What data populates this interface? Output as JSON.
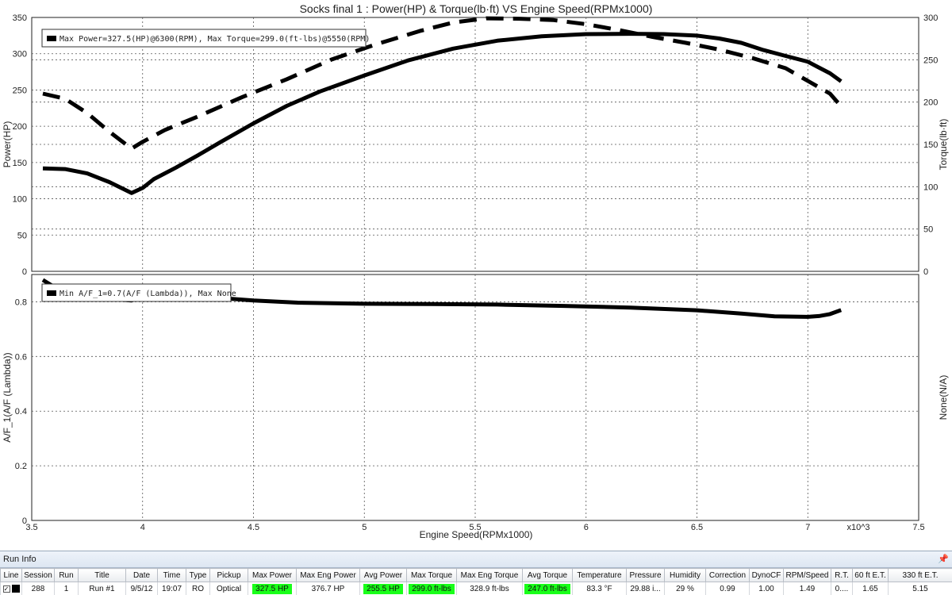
{
  "chart_data": [
    {
      "type": "line",
      "title": "Socks final 1 : Power(HP) & Torque(lb·ft) VS Engine Speed(RPMx1000)",
      "ylabel": "Power(HP)",
      "ylabel_right": "Torque(lb·ft)",
      "ylim": [
        0,
        350
      ],
      "ylim_right": [
        0,
        300
      ],
      "yticks": [
        "0",
        "50",
        "100",
        "150",
        "200",
        "250",
        "300",
        "350"
      ],
      "yticks_right": [
        "0",
        "50",
        "100",
        "150",
        "200",
        "250",
        "300"
      ],
      "grid": true,
      "legend": "Max Power=327.5(HP)@6300(RPM), Max Torque=299.0(ft-lbs)@5550(RPM)",
      "legend_position": "top-left",
      "series": [
        {
          "axis": "left",
          "style": "solid",
          "x": [
            3.55,
            3.65,
            3.75,
            3.85,
            3.95,
            4.0,
            4.05,
            4.15,
            4.25,
            4.35,
            4.5,
            4.65,
            4.8,
            5.0,
            5.2,
            5.4,
            5.6,
            5.8,
            6.0,
            6.2,
            6.35,
            6.5,
            6.6,
            6.7,
            6.8,
            6.9,
            7.0,
            7.05,
            7.1,
            7.15
          ],
          "values": [
            142,
            141,
            135,
            123,
            108,
            115,
            127,
            143,
            160,
            178,
            204,
            228,
            248,
            270,
            291,
            307,
            318,
            324,
            327,
            327.5,
            327,
            325,
            321,
            315,
            305,
            297,
            289,
            281,
            273,
            262
          ]
        },
        {
          "axis": "right",
          "style": "dashed",
          "x": [
            3.55,
            3.65,
            3.75,
            3.85,
            3.95,
            4.0,
            4.1,
            4.25,
            4.45,
            4.65,
            4.85,
            5.05,
            5.25,
            5.4,
            5.55,
            5.7,
            5.85,
            6.0,
            6.15,
            6.3,
            6.45,
            6.6,
            6.75,
            6.9,
            7.0,
            7.1,
            7.15
          ],
          "values": [
            210,
            204,
            187,
            165,
            145,
            153,
            167,
            183,
            206,
            227,
            250,
            268,
            284,
            294,
            299,
            298.5,
            297,
            292,
            285,
            277,
            270,
            262,
            252,
            240,
            225,
            210,
            195
          ]
        }
      ]
    },
    {
      "type": "line",
      "ylabel": "A/F_1(A/F (Lambda))",
      "ylabel_right": "None(N/A)",
      "xlabel": "Engine Speed(RPMx1000)",
      "x_unit": "x10^3",
      "xlim": [
        3.5,
        7.5
      ],
      "xticks": [
        "3.5",
        "4",
        "4.5",
        "5",
        "5.5",
        "6",
        "6.5",
        "7",
        "7.5"
      ],
      "ylim": [
        0,
        0.9
      ],
      "yticks": [
        "0",
        "0.2",
        "0.4",
        "0.6",
        "0.8"
      ],
      "grid": true,
      "legend": "Min A/F_1=0.7(A/F (Lambda)), Max None",
      "legend_position": "top-left",
      "series": [
        {
          "axis": "left",
          "style": "solid",
          "x": [
            3.55,
            3.6,
            3.7,
            3.8,
            3.9,
            3.95,
            4.0,
            4.05,
            4.1,
            4.2,
            4.3,
            4.5,
            4.7,
            5.0,
            5.3,
            5.6,
            5.9,
            6.2,
            6.5,
            6.7,
            6.85,
            7.0,
            7.05,
            7.1,
            7.15
          ],
          "values": [
            0.88,
            0.855,
            0.83,
            0.815,
            0.808,
            0.805,
            0.818,
            0.825,
            0.826,
            0.824,
            0.817,
            0.805,
            0.797,
            0.793,
            0.792,
            0.79,
            0.785,
            0.779,
            0.769,
            0.757,
            0.747,
            0.745,
            0.748,
            0.755,
            0.77
          ]
        }
      ]
    }
  ],
  "run_info": {
    "title": "Run Info",
    "pin_icon": "pin-icon",
    "columns": [
      "Line",
      "Session",
      "Run",
      "Title",
      "Date",
      "Time",
      "Type",
      "Pickup",
      "Max Power",
      "Max Eng Power",
      "Avg Power",
      "Max Torque",
      "Max Eng Torque",
      "Avg Torque",
      "Temperature",
      "Pressure",
      "Humidity",
      "Correction",
      "DynoCF",
      "RPM/Speed",
      "R.T.",
      "60 ft E.T.",
      "330 ft E.T."
    ],
    "row": {
      "checked": "✓",
      "line_color": "#000000",
      "session": "288",
      "run": "1",
      "title": "Run #1",
      "date": "9/5/12",
      "time": "19:07",
      "type": "RO",
      "pickup": "Optical",
      "max_power": "327.5 HP",
      "max_eng_power": "376.7 HP",
      "avg_power": "255.5 HP",
      "max_torque": "299.0 ft-lbs",
      "max_eng_torque": "328.9 ft-lbs",
      "avg_torque": "247.0 ft-lbs",
      "temperature": "83.3 °F",
      "pressure": "29.88 i...",
      "humidity": "29 %",
      "correction": "0.99",
      "dynocf": "1.00",
      "rpm_speed": "1.49",
      "rt": "0....",
      "et60": "1.65",
      "et330": "5.15"
    },
    "highlight_color": "#19ff19"
  }
}
